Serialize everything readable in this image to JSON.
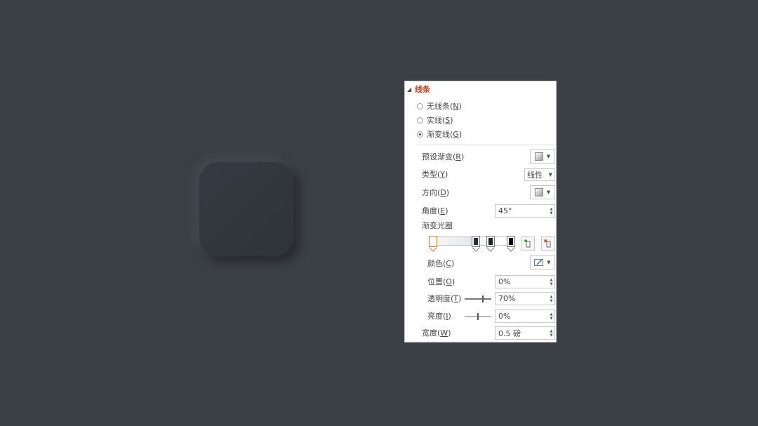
{
  "section": {
    "title": "线条",
    "options": [
      {
        "label": "无线条(",
        "key": "N",
        "suffix": ")",
        "selected": false
      },
      {
        "label": "实线(",
        "key": "S",
        "suffix": ")",
        "selected": false
      },
      {
        "label": "渐变线(",
        "key": "G",
        "suffix": ")",
        "selected": true
      }
    ]
  },
  "fields": {
    "preset": {
      "label": "预设渐变(",
      "key": "R",
      "suffix": ")",
      "icon": "gradient-swatch-icon"
    },
    "type": {
      "label": "类型(",
      "key": "Y",
      "suffix": ")",
      "value": "线性"
    },
    "direction": {
      "label": "方向(",
      "key": "D",
      "suffix": ")",
      "icon": "gradient-swatch-icon"
    },
    "angle": {
      "label": "角度(",
      "key": "E",
      "suffix": ")",
      "value": "45°"
    },
    "stops_label": "渐变光圈",
    "color": {
      "label": "颜色(",
      "key": "C",
      "suffix": ")",
      "icon": "pen-color-icon"
    },
    "position": {
      "label": "位置(",
      "key": "O",
      "suffix": ")",
      "value": "0%"
    },
    "transparency": {
      "label": "透明度(",
      "key": "T",
      "suffix": ")",
      "value": "70%",
      "level": 0.7
    },
    "brightness": {
      "label": "亮度(",
      "key": "I",
      "suffix": ")",
      "value": "0%",
      "level": 0.5
    },
    "width": {
      "label": "宽度(",
      "key": "W",
      "suffix": ")",
      "value": "0.5 磅"
    }
  },
  "gradient_stops": [
    {
      "color": "#ffffff",
      "selected": true
    },
    {
      "color": "#2a2e35",
      "selected": false
    },
    {
      "color": "#1f2227",
      "selected": false
    },
    {
      "color": "#000000",
      "selected": false
    }
  ],
  "colors": {
    "background": "#3b3f46",
    "shape": "#32363d",
    "accent_title": "#c43e1c",
    "stop_selected_border": "#d07a35"
  }
}
